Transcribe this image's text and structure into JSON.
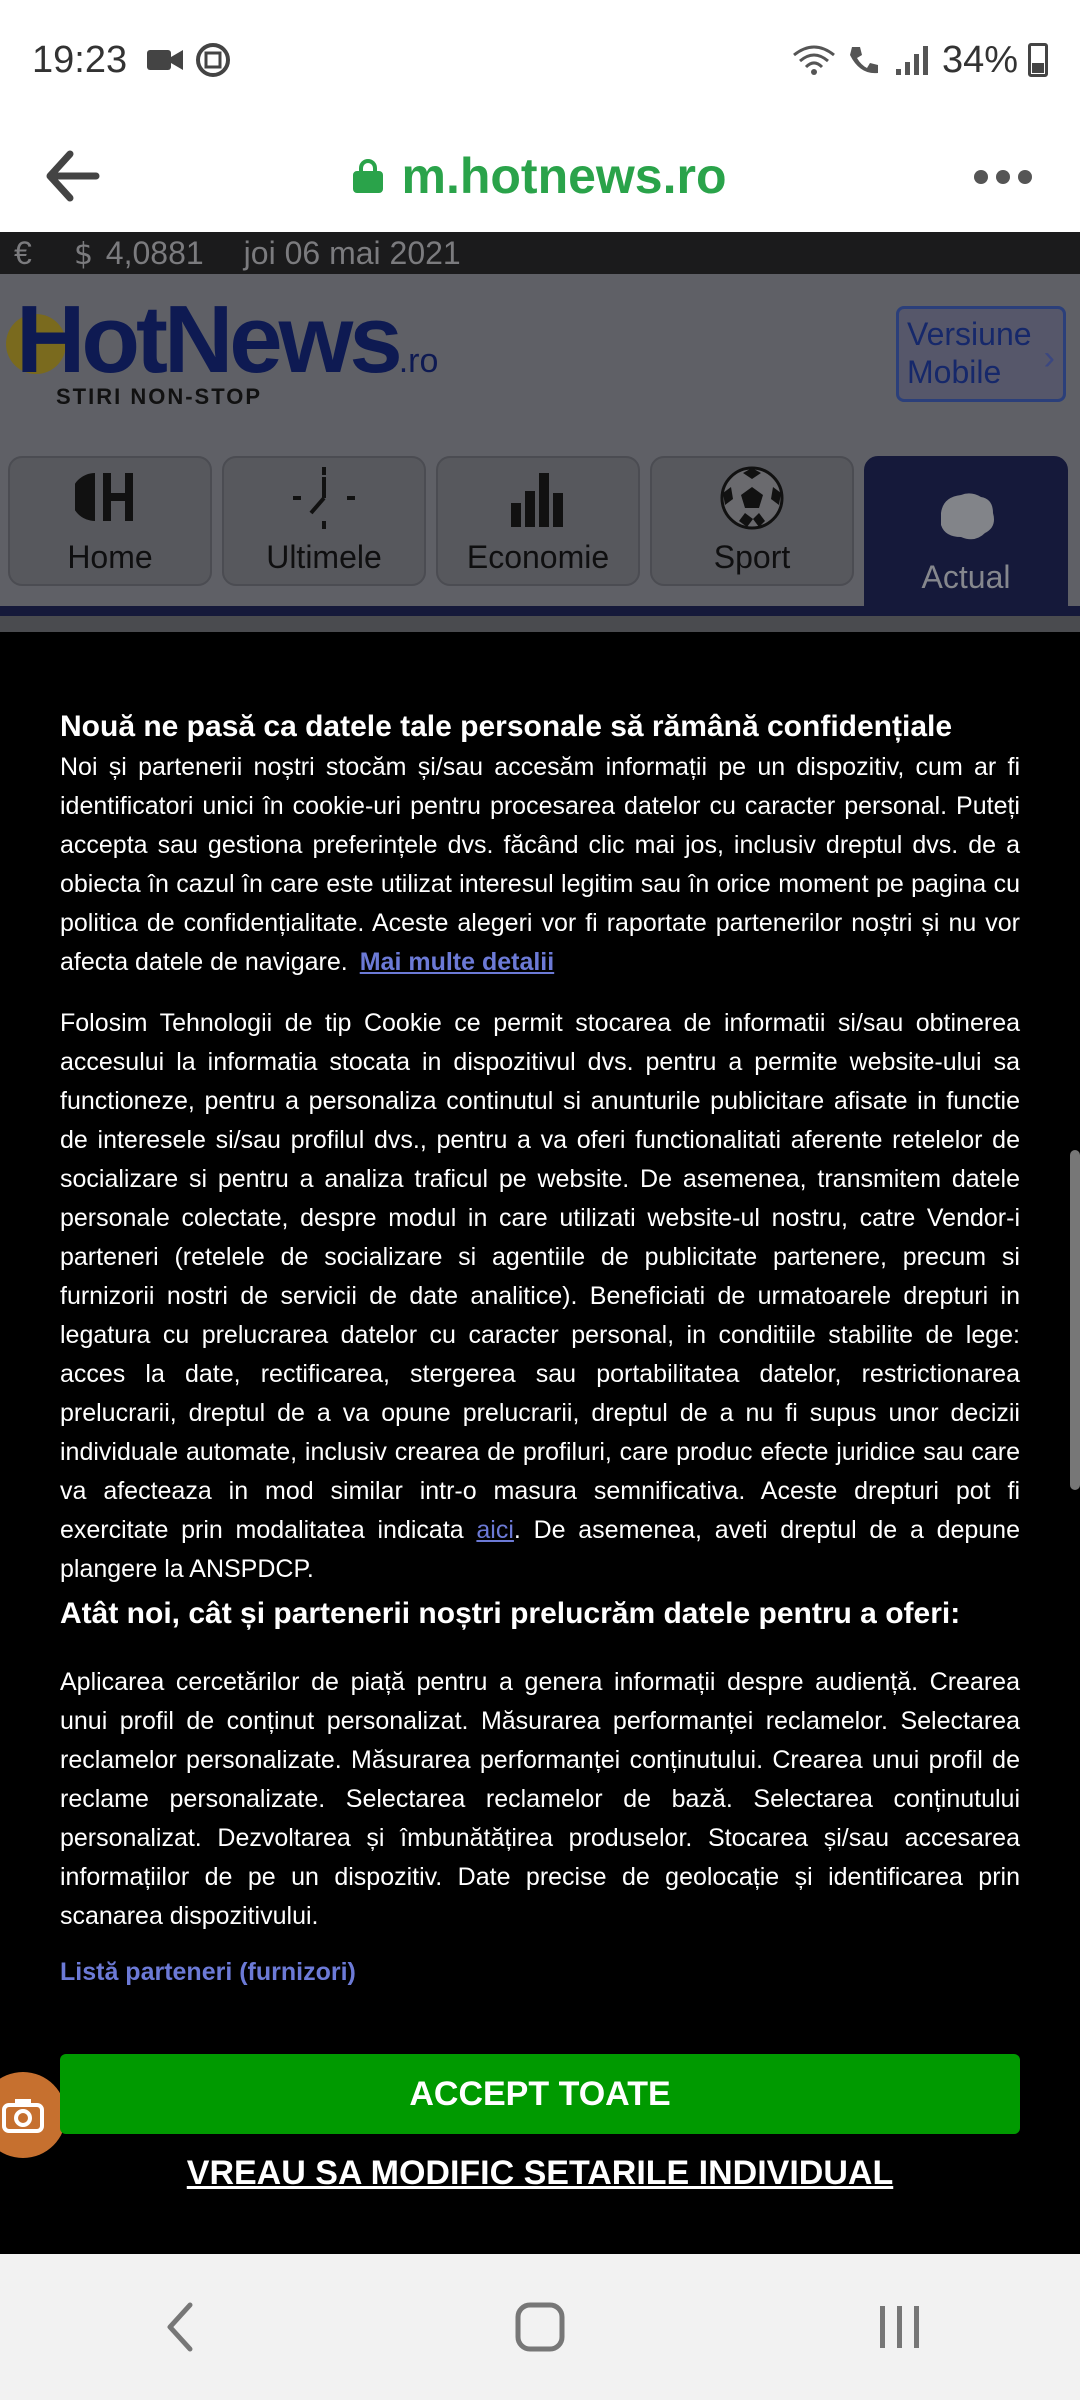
{
  "status_bar": {
    "time": "19:23",
    "battery": "34%"
  },
  "url_bar": {
    "url": "m.hotnews.ro"
  },
  "site": {
    "ticker": {
      "currency_icon": "€",
      "rate": "4,0881",
      "date": "joi 06 mai 2021"
    },
    "logo": {
      "main": "HotNews",
      "suffix": ".ro",
      "tagline": "STIRI NON-STOP"
    },
    "version_button": "Versiune Mobile",
    "tabs": [
      {
        "label": "Home",
        "icon": "home-icon"
      },
      {
        "label": "Ultimele",
        "icon": "clock-icon"
      },
      {
        "label": "Economie",
        "icon": "bar-chart-icon"
      },
      {
        "label": "Sport",
        "icon": "soccer-ball-icon"
      },
      {
        "label": "Actual",
        "icon": "map-icon"
      }
    ]
  },
  "consent": {
    "title": "Nouă ne pasă ca datele tale personale să rămână confidențiale",
    "para1": "Noi și partenerii noștri stocăm și/sau accesăm informații pe un dispozitiv, cum ar fi identificatori unici în cookie-uri pentru procesarea datelor cu caracter personal. Puteți accepta sau gestiona preferințele dvs. făcând clic mai jos, inclusiv dreptul dvs. de a obiecta în cazul în care este utilizat interesul legitim sau în orice moment pe pagina cu politica de confidențialitate. Aceste alegeri vor fi raportate partenerilor noștri și nu vor afecta datele de navigare.",
    "more_details": "Mai multe detalii",
    "para2": "Folosim Tehnologii de tip Cookie ce permit stocarea de informatii si/sau obtinerea accesului la informatia stocata in dispozitivul dvs. pentru a permite website-ului sa functioneze, pentru a personaliza continutul si anunturile publicitare afisate in functie de interesele si/sau profilul dvs., pentru a va oferi functionalitati aferente retelelor de socializare si pentru a analiza traficul pe website. De asemenea, transmitem datele personale colectate, despre modul in care utilizati website-ul nostru, catre Vendor-i parteneri (retelele de socializare si agentiile de publicitate partenere, precum si furnizorii nostri de servicii de date analitice). Beneficiati de urmatoarele drepturi in legatura cu prelucrarea datelor cu caracter personal, in conditiile stabilite de lege: acces la date, rectificarea, stergerea sau portabilitatea datelor, restrictionarea prelucrarii, dreptul de a va opune prelucrarii, dreptul de a nu fi supus unor decizii individuale automate, inclusiv crearea de profiluri, care produc efecte juridice sau care va afecteaza in mod similar intr-o masura semnificativa. Aceste drepturi pot fi exercitate prin modalitatea indicata",
    "here_link": "aici",
    "para2_end": ". De asemenea, aveti dreptul de a depune plangere la ANSPDCP.",
    "subtitle": "Atât noi, cât și partenerii noștri prelucrăm datele pentru a oferi:",
    "para3": "Aplicarea cercetărilor de piață pentru a genera informații despre audiență. Crearea unui profil de conținut personalizat. Măsurarea performanței reclamelor. Selectarea reclamelor personalizate. Măsurarea performanței conținutului. Crearea unui profil de reclame personalizate. Selectarea reclamelor de bază. Selectarea conținutului personalizat. Dezvoltarea și îmbunătățirea produselor. Stocarea și/sau accesarea informațiilor de pe un dispozitiv. Date precise de geolocație și identificarea prin scanarea dispozitivului.",
    "partners_link": "Listă parteneri (furnizori)",
    "accept_button": "ACCEPT TOATE",
    "modify_link": "VREAU SA MODIFIC SETARILE INDIVIDUAL"
  },
  "colors": {
    "accent_green": "#009a00",
    "link_blue": "#6c7ad6",
    "url_green": "#2aa34a"
  }
}
